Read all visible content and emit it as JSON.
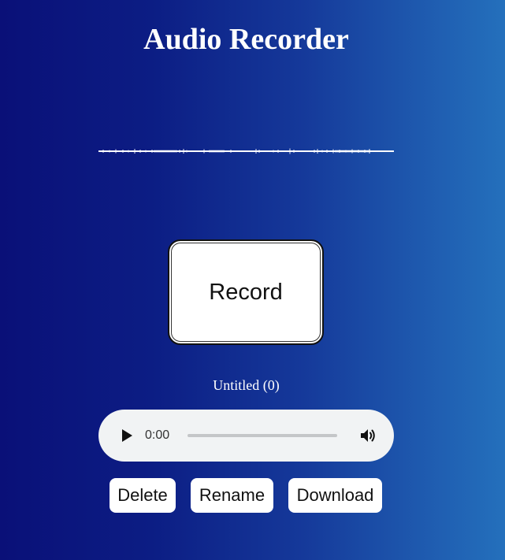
{
  "app": {
    "title": "Audio Recorder"
  },
  "recorder": {
    "record_label": "Record"
  },
  "recording": {
    "name": "Untitled (0)",
    "current_time": "0:00",
    "progress": 0
  },
  "actions": {
    "delete_label": "Delete",
    "rename_label": "Rename",
    "download_label": "Download"
  },
  "icons": {
    "play": "play-icon",
    "volume": "volume-icon"
  },
  "colors": {
    "background_start": "#0a1078",
    "background_end": "#2470bc",
    "waveform": "#ffffff",
    "player_background": "#f1f3f4"
  }
}
